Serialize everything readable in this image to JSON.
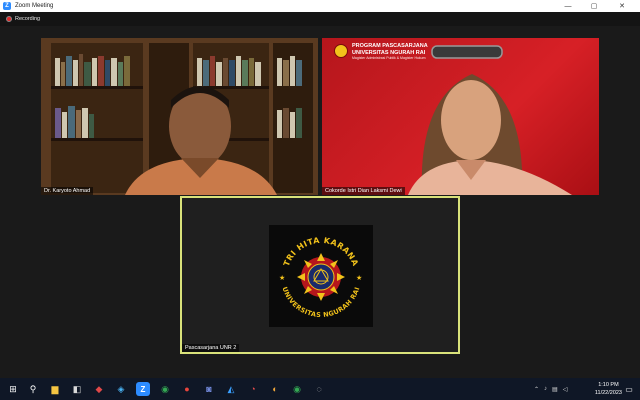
{
  "window": {
    "title": "Zoom Meeting",
    "app_icon": "Z",
    "minimize": "—",
    "maximize": "▢",
    "close": "✕"
  },
  "recording": {
    "label": "Recording"
  },
  "participants": [
    {
      "name": "Dr. Karyoto Ahmad"
    },
    {
      "name": "Cokorde Istri Dian Laksmi Dewi"
    },
    {
      "name": "Pascasarjana UNR 2"
    }
  ],
  "slide": {
    "title_line1": "PROGRAM PASCASARJANA",
    "title_line2": "UNIVERSITAS NGURAH RAI",
    "subtitle": "Magister Administrasi Publik & Magister Hukum"
  },
  "logo": {
    "top_text": "TRI HITA KARANA",
    "bottom_text": "UNIVERSITAS NGURAH RAI"
  },
  "taskbar": {
    "time": "1:10 PM",
    "date": "11/22/2023"
  },
  "colors": {
    "active_border": "#d9e27a",
    "zoom_blue": "#2d8cff",
    "record_red": "#e02828",
    "slide_red": "#d72026",
    "logo_yellow": "#f2c21b"
  }
}
